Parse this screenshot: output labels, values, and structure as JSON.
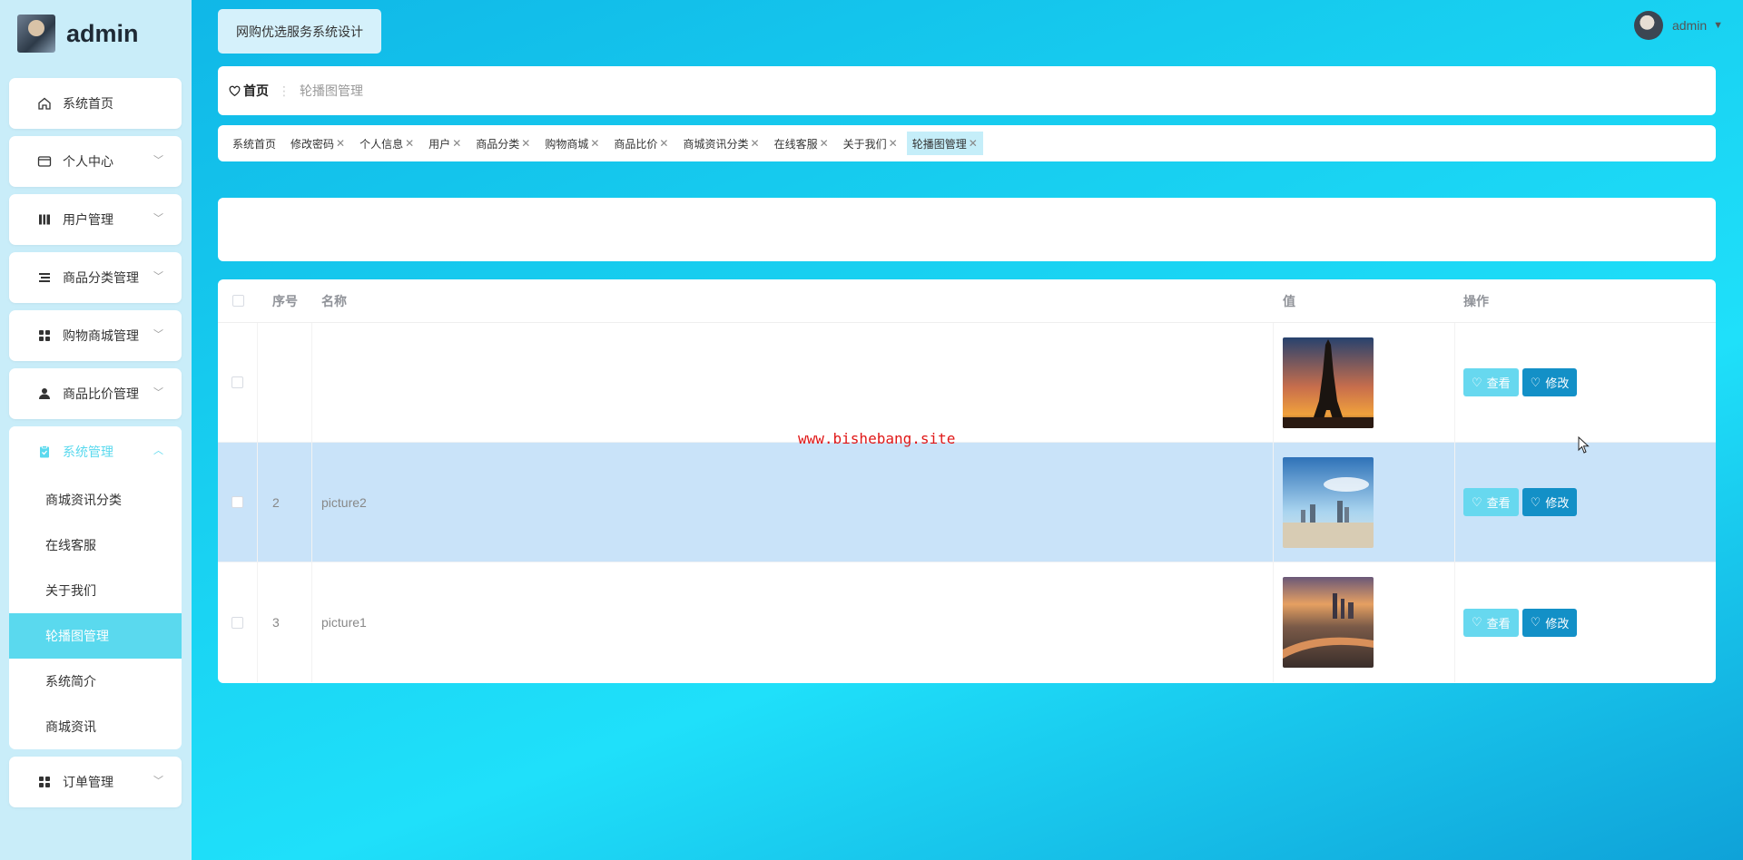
{
  "brand": {
    "name": "admin"
  },
  "header": {
    "title": "网购优选服务系统设计",
    "user_name": "admin"
  },
  "sidebar": {
    "items": [
      {
        "label": "系统首页",
        "icon": "home-icon"
      },
      {
        "label": "个人中心",
        "icon": "id-card-icon"
      },
      {
        "label": "用户管理",
        "icon": "book-icon"
      },
      {
        "label": "商品分类管理",
        "icon": "list-icon"
      },
      {
        "label": "购物商城管理",
        "icon": "grid-icon"
      },
      {
        "label": "商品比价管理",
        "icon": "user-icon"
      },
      {
        "label": "系统管理",
        "icon": "clipboard-icon"
      },
      {
        "label": "订单管理",
        "icon": "grid-icon"
      }
    ],
    "system_sub": [
      {
        "label": "商城资讯分类"
      },
      {
        "label": "在线客服"
      },
      {
        "label": "关于我们"
      },
      {
        "label": "轮播图管理"
      },
      {
        "label": "系统简介"
      },
      {
        "label": "商城资讯"
      }
    ]
  },
  "breadcrumb": {
    "home": "首页",
    "separator": "⋮",
    "current": "轮播图管理"
  },
  "tabs": [
    {
      "label": "系统首页",
      "closable": false
    },
    {
      "label": "修改密码",
      "closable": true
    },
    {
      "label": "个人信息",
      "closable": true
    },
    {
      "label": "用户",
      "closable": true
    },
    {
      "label": "商品分类",
      "closable": true
    },
    {
      "label": "购物商城",
      "closable": true
    },
    {
      "label": "商品比价",
      "closable": true
    },
    {
      "label": "商城资讯分类",
      "closable": true
    },
    {
      "label": "在线客服",
      "closable": true
    },
    {
      "label": "关于我们",
      "closable": true
    },
    {
      "label": "轮播图管理",
      "closable": true
    }
  ],
  "table": {
    "headers": {
      "index": "序号",
      "name": "名称",
      "value": "值",
      "op": "操作"
    },
    "rows": [
      {
        "index": "",
        "name": "",
        "image": "eiffel-tower-sunset-image"
      },
      {
        "index": "2",
        "name": "picture2",
        "image": "city-skyline-image"
      },
      {
        "index": "3",
        "name": "picture1",
        "image": "river-city-aerial-image"
      }
    ],
    "view_label": "查看",
    "edit_label": "修改",
    "highlighted_row": 2
  },
  "watermark": "www.bishebang.site",
  "colors": {
    "accent": "#5ad9ee",
    "edit_button": "#1390c7",
    "view_button": "#67d8ef",
    "row_highlight": "#c9e3f9"
  }
}
